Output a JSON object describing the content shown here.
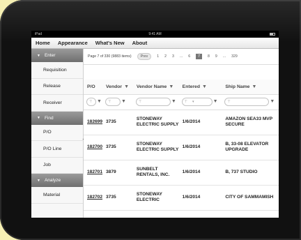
{
  "statusbar": {
    "carrier": "iPad",
    "time": "9:41 AM"
  },
  "menubar": {
    "items": [
      "Home",
      "Appearance",
      "What's New",
      "About"
    ]
  },
  "sidebar": {
    "sections": [
      {
        "label": "Enter",
        "items": [
          "Requisition",
          "Release",
          "Receiver"
        ]
      },
      {
        "label": "Find",
        "items": [
          "P/O",
          "P/O Line",
          "Job"
        ]
      },
      {
        "label": "Analyze",
        "items": [
          "Material"
        ]
      }
    ]
  },
  "pager": {
    "info": "Page 7 of 330 (9883 items)",
    "prev": "Prev",
    "pages": [
      "1",
      "2",
      "3",
      "...",
      "6",
      "7",
      "8",
      "9",
      "...",
      "329"
    ],
    "current": "7"
  },
  "grid": {
    "columns": [
      "P/O",
      "Vendor",
      "Vendor Name",
      "Entered",
      "Ship Name"
    ],
    "rows": [
      {
        "po": "182699",
        "vendor": "3735",
        "vendor_name": "STONEWAY ELECTRIC SUPPLY",
        "entered": "1/6/2014",
        "ship_name": "AMAZON SEA33 MVP SECURE"
      },
      {
        "po": "182700",
        "vendor": "3735",
        "vendor_name": "STONEWAY ELECTRIC SUPPLY",
        "entered": "1/6/2014",
        "ship_name": "B, 33-08 ELEVATOR UPGRADE"
      },
      {
        "po": "182701",
        "vendor": "3879",
        "vendor_name": "SUNBELT RENTALS, INC.",
        "entered": "1/6/2014",
        "ship_name": "B, 737 STUDIO"
      },
      {
        "po": "182702",
        "vendor": "3735",
        "vendor_name": "STONEWAY ELECTRIC",
        "entered": "1/6/2014",
        "ship_name": "CITY OF SAMMAMISH"
      }
    ]
  }
}
